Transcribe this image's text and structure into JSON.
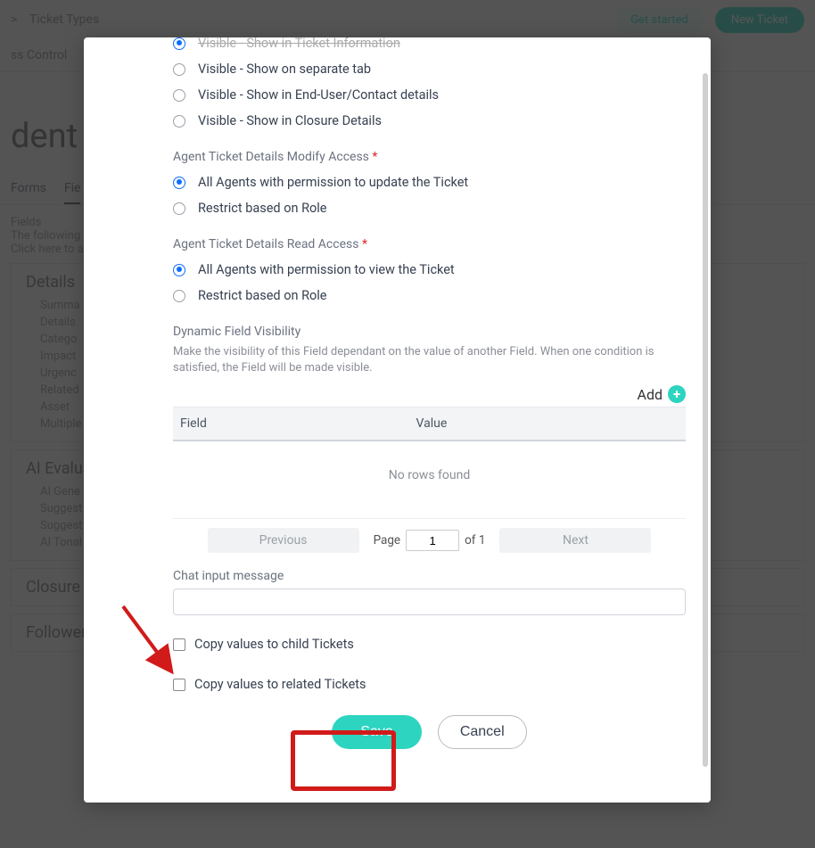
{
  "bg": {
    "breadcrumb_sep": ">",
    "breadcrumb": "Ticket Types",
    "get_started": "Get started",
    "new_ticket": "New Ticket",
    "sub_tab_1": "ss Control",
    "title": "dent",
    "tab_forms": "Forms",
    "tab_fields": "Fie",
    "fields_label": "Fields",
    "fields_desc": "The following Fie",
    "fields_hint": "Click here to ad",
    "details_heading": "Details",
    "details_items": [
      "Summa",
      "Details",
      "Catego",
      "Impact",
      "Urgenc",
      "Related",
      "Asset",
      "Multiple"
    ],
    "ai_heading": "AI Evalua",
    "ai_items": [
      "AI Gene",
      "Suggest",
      "Suggest",
      "AI Tonal"
    ],
    "closure_heading": "Closure",
    "followers_heading": "Follower"
  },
  "modal": {
    "vis_opts": {
      "info": "Visible - Show in Ticket Information",
      "tab": "Visible - Show on separate tab",
      "contact": "Visible - Show in End-User/Contact details",
      "closure": "Visible - Show in Closure Details"
    },
    "modify_label": "Agent Ticket Details Modify Access",
    "modify_opts": {
      "all": "All Agents with permission to update the Ticket",
      "role": "Restrict based on Role"
    },
    "read_label": "Agent Ticket Details Read Access",
    "read_opts": {
      "all": "All Agents with permission to view the Ticket",
      "role": "Restrict based on Role"
    },
    "dyn_label": "Dynamic Field Visibility",
    "dyn_help": "Make the visibility of this Field dependant on the value of another Field. When one condition is satisfied, the Field will be made visible.",
    "add": "Add",
    "th_field": "Field",
    "th_value": "Value",
    "empty": "No rows found",
    "prev": "Previous",
    "page_label": "Page",
    "page_val": "1",
    "page_of": "of 1",
    "next": "Next",
    "chat_label": "Chat input message",
    "chat_value": "",
    "copy_child": "Copy values to child Tickets",
    "copy_related": "Copy values to related Tickets",
    "save": "Save",
    "cancel": "Cancel"
  }
}
